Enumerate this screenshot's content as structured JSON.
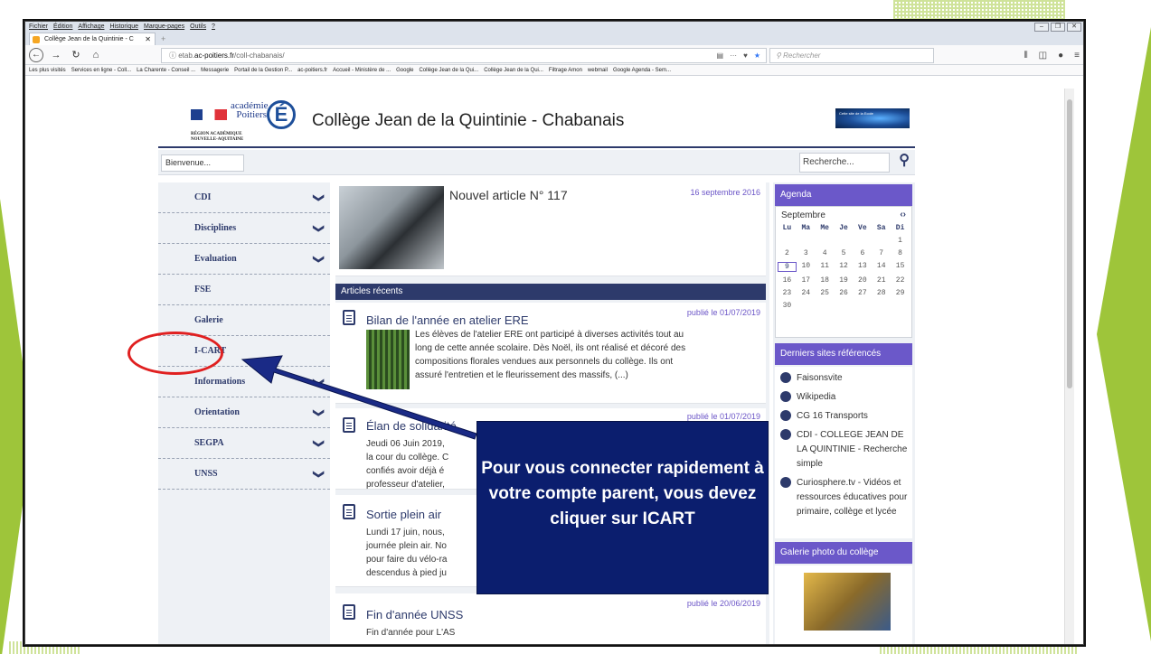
{
  "browser": {
    "menu": [
      "Fichier",
      "Édition",
      "Affichage",
      "Historique",
      "Marque-pages",
      "Outils",
      "?"
    ],
    "tab_title": "Collège Jean de la Quintinie - C",
    "tab_close": "✕",
    "new_tab": "+",
    "url_prefix": "ⓘ etab.",
    "url_domain": "ac-poitiers.fr",
    "url_path": "/coll-chabanais/",
    "search_placeholder": "Rechercher",
    "bookmarks": [
      "Les plus visités",
      "Services en ligne - Coll...",
      "La Charente - Conseil ...",
      "Messagerie",
      "Portail de la Gestion P...",
      "ac-poitiers.fr",
      "Accueil - Ministère de ...",
      "Google",
      "Collège Jean de la Qui...",
      "Collège Jean de la Qui...",
      "Filtrage Amon",
      "webmail",
      "Google Agenda - Sem..."
    ]
  },
  "site": {
    "logo_text": "académie\nPoitiers",
    "logo_letter": "É",
    "region_line1": "RÉGION ACADÉMIQUE",
    "region_line2": "NOUVELLE-AQUITAINE",
    "title": "Collège Jean de la Quintinie - Chabanais",
    "banner_text": "Cette site de la Ecole",
    "breadcrumb": "Bienvenue...",
    "search_placeholder": "Recherche...",
    "sidebar": [
      {
        "label": "CDI",
        "chevron": true
      },
      {
        "label": "Disciplines",
        "chevron": true
      },
      {
        "label": "Evaluation",
        "chevron": true
      },
      {
        "label": "FSE",
        "chevron": false
      },
      {
        "label": "Galerie",
        "chevron": false
      },
      {
        "label": "I-CART",
        "chevron": false
      },
      {
        "label": "Informations",
        "chevron": true
      },
      {
        "label": "Orientation",
        "chevron": true
      },
      {
        "label": "SEGPA",
        "chevron": true
      },
      {
        "label": "UNSS",
        "chevron": true
      }
    ],
    "featured": {
      "title": "Nouvel article N° 117",
      "date": "16 septembre 2016"
    },
    "recent_header": "Articles récents",
    "articles": [
      {
        "title": "Bilan de l'année en atelier ERE",
        "date": "publié le 01/07/2019",
        "lines": [
          "Les élèves de l'atelier ERE ont participé à diverses activités tout au",
          "long de cette année scolaire. Dès Noël, ils ont réalisé et décoré des",
          "compositions florales vendues aux personnels du collège. Ils ont",
          "assuré l'entretien et le fleurissement des massifs, (...)"
        ]
      },
      {
        "title": "Élan de solidarité",
        "date": "publié le 01/07/2019",
        "lines": [
          "Jeudi 06 Juin 2019,",
          "la cour du collège. C",
          "confiés avoir déjà é",
          "professeur d'atelier,"
        ]
      },
      {
        "title": "Sortie plein air",
        "date": "",
        "lines": [
          "Lundi 17 juin, nous,",
          "journée plein air. No",
          "pour faire du vélo-ra",
          "descendus à pied ju"
        ]
      },
      {
        "title": "Fin d'année UNSS",
        "date": "publié le 20/06/2019",
        "lines": [
          "Fin d'année pour L'AS"
        ]
      }
    ],
    "agenda": {
      "header": "Agenda",
      "month": "Septembre",
      "nav": "‹›",
      "dow": [
        "Lu",
        "Ma",
        "Me",
        "Je",
        "Ve",
        "Sa",
        "Di"
      ],
      "days": [
        "",
        "",
        "",
        "",
        "",
        "",
        "1",
        "2",
        "3",
        "4",
        "5",
        "6",
        "7",
        "8",
        "9",
        "10",
        "11",
        "12",
        "13",
        "14",
        "15",
        "16",
        "17",
        "18",
        "19",
        "20",
        "21",
        "22",
        "23",
        "24",
        "25",
        "26",
        "27",
        "28",
        "29",
        "30",
        "",
        "",
        "",
        "",
        "",
        ""
      ],
      "today": "9"
    },
    "links_header": "Derniers sites référencés",
    "links": [
      "Faisonsvite",
      "Wikipedia",
      "CG 16 Transports",
      "CDI - COLLEGE JEAN DE LA QUINTINIE - Recherche simple",
      "Curiosphere.tv - Vidéos et ressources éducatives pour primaire, collège et lycée"
    ],
    "gallery_header": "Galerie photo du collège"
  },
  "callout": {
    "text": "Pour vous connecter rapidement à votre compte parent, vous devez cliquer sur ICART"
  },
  "colors": {
    "navy": "#2d3a6b",
    "purple": "#6b58c9",
    "callout": "#0b1e6e",
    "ring": "#e02020",
    "green": "#9ec53a"
  }
}
